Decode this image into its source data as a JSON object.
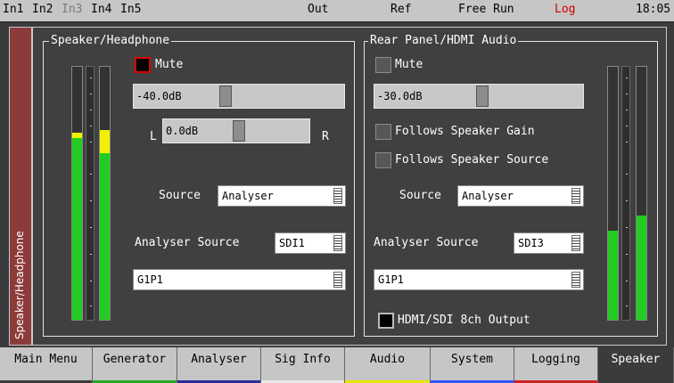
{
  "topbar": {
    "inputs": [
      {
        "label": "In1",
        "dim": false
      },
      {
        "label": "In2",
        "dim": false
      },
      {
        "label": "In3",
        "dim": true
      },
      {
        "label": "In4",
        "dim": false
      },
      {
        "label": "In5",
        "dim": false
      }
    ],
    "out": "Out",
    "ref": "Ref",
    "mode": "Free Run",
    "log": "Log",
    "time": "18:05"
  },
  "side_tab": "Speaker/Headphone",
  "speaker": {
    "title": "Speaker/Headphone",
    "mute_label": "Mute",
    "mute_on": true,
    "gain": "-40.0dB",
    "gain_fraction": 0.48,
    "balance": "0.0dB",
    "balance_fraction": 0.5,
    "left_label": "L",
    "right_label": "R",
    "source_label": "Source",
    "source_value": "Analyser",
    "analyser_source_label": "Analyser Source",
    "analyser_source_value": "SDI1",
    "channel_value": "G1P1",
    "meters": [
      0.74,
      0.75
    ],
    "peaks": [
      0.7,
      0.72
    ]
  },
  "rear": {
    "title": "Rear Panel/HDMI Audio",
    "mute_label": "Mute",
    "mute_on": false,
    "gain": "-30.0dB",
    "gain_fraction": 0.5,
    "follows_gain_label": "Follows Speaker Gain",
    "follows_source_label": "Follows Speaker Source",
    "source_label": "Source",
    "source_value": "Analyser",
    "analyser_source_label": "Analyser Source",
    "analyser_source_value": "SDI3",
    "channel_value": "G1P1",
    "hdmi_label": "HDMI/SDI 8ch Output",
    "hdmi_on": true,
    "meters": [
      0.34,
      0.4
    ],
    "peaks": [
      0.37,
      0.45
    ]
  },
  "tabs": [
    {
      "label": "Main Menu",
      "color": "#3b3b3b",
      "active": false
    },
    {
      "label": "Generator",
      "color": "#22aa22",
      "active": false
    },
    {
      "label": "Analyser",
      "color": "#2b2b9a",
      "active": false
    },
    {
      "label": "Sig Info",
      "color": "#e8e8e8",
      "active": false
    },
    {
      "label": "Audio",
      "color": "#e6e600",
      "active": false
    },
    {
      "label": "System",
      "color": "#3355ff",
      "active": false
    },
    {
      "label": "Logging",
      "color": "#cc2222",
      "active": false
    },
    {
      "label": "Speaker",
      "color": "#3b3b3b",
      "active": true
    }
  ],
  "colors": {
    "meter_green": "#22cc22",
    "meter_yellow": "#f0f000",
    "mute_red": "#dd0000"
  }
}
